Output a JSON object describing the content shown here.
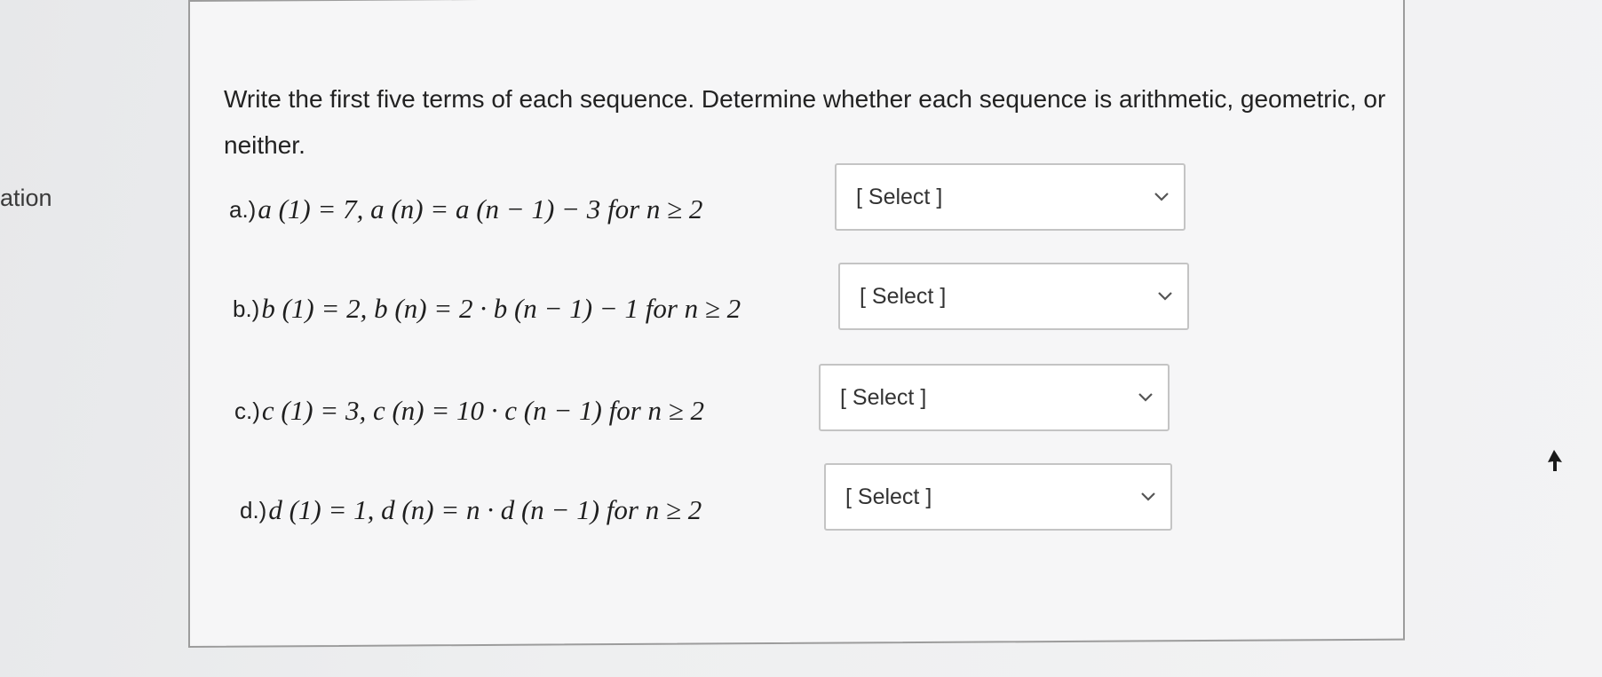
{
  "sidebar": {
    "partial_label": "ation"
  },
  "question": {
    "text": "Write the first five terms of each sequence. Determine whether each sequence is arithmetic, geometric, or neither."
  },
  "items": [
    {
      "label": "a.)",
      "formula": "a (1) = 7,  a (n) = a (n − 1) − 3  for n ≥ 2",
      "select": "[ Select ]"
    },
    {
      "label": "b.)",
      "formula": "b (1) = 2,  b (n) = 2 · b (n − 1) − 1  for n ≥ 2",
      "select": "[ Select ]"
    },
    {
      "label": "c.)",
      "formula": "c (1) = 3,  c (n) = 10 · c (n − 1)  for n ≥ 2",
      "select": "[ Select ]"
    },
    {
      "label": "d.)",
      "formula": "d (1) = 1,  d (n) = n · d (n − 1)  for n ≥ 2",
      "select": "[ Select ]"
    }
  ],
  "icons": {
    "dropdown": "chevron-down-icon",
    "pointer": "mouse-cursor-icon"
  }
}
